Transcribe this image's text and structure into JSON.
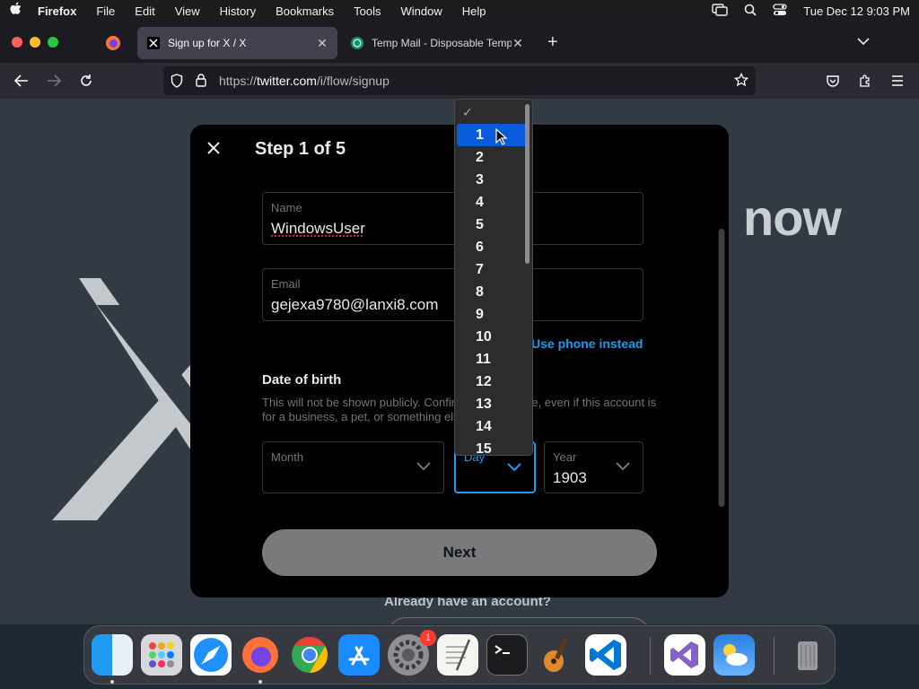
{
  "menubar": {
    "app_name": "Firefox",
    "items": [
      "File",
      "Edit",
      "View",
      "History",
      "Bookmarks",
      "Tools",
      "Window",
      "Help"
    ],
    "clock": "Tue Dec 12  9:03 PM"
  },
  "tabs": [
    {
      "label": "Sign up for X / X",
      "active": true
    },
    {
      "label": "Temp Mail - Disposable Tempor",
      "active": false
    }
  ],
  "urlbar": {
    "prefix": "https://",
    "host": "twitter.com",
    "path": "/i/flow/signup"
  },
  "background": {
    "headline_fragment": "now",
    "footer_fragment": "Already have an account?"
  },
  "signup": {
    "step": "Step 1 of 5",
    "name_label": "Name",
    "name_value": "WindowsUser",
    "email_label": "Email",
    "email_value": "gejexa9780@lanxi8.com",
    "use_phone": "Use phone instead",
    "dob_title": "Date of birth",
    "dob_desc": "This will not be shown publicly. Confirm your own age, even if this account is for a business, a pet, or something else.",
    "month_label": "Month",
    "month_value": "",
    "day_label": "Day",
    "year_label": "Year",
    "year_value": "1903",
    "next_label": "Next"
  },
  "day_dropdown": {
    "check": "✓",
    "options": [
      "1",
      "2",
      "3",
      "4",
      "5",
      "6",
      "7",
      "8",
      "9",
      "10",
      "11",
      "12",
      "13",
      "14",
      "15"
    ],
    "highlighted": "1"
  },
  "dock": {
    "apps": [
      "finder-icon",
      "launchpad-icon",
      "safari-icon",
      "firefox-icon",
      "chrome-icon",
      "app-store-icon",
      "system-settings-icon",
      "textedit-icon",
      "terminal-icon",
      "garageband-icon",
      "vscode-icon",
      "visual-studio-icon",
      "weather-icon",
      "trash-icon"
    ],
    "settings_badge": "1"
  }
}
